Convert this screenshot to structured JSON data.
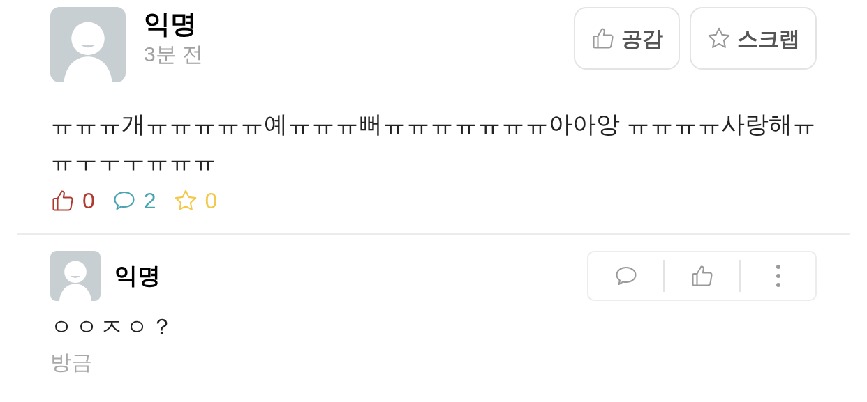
{
  "post": {
    "author": "익명",
    "time": "3분 전",
    "buttons": [
      {
        "kind": "like",
        "label": "공감"
      },
      {
        "kind": "scrap",
        "label": "스크랩"
      }
    ],
    "body": "ㅠㅠㅠ개ㅠㅠㅠㅠㅠ예ㅠㅠㅠ뻐ㅠㅠㅠㅠㅠㅠㅠ아아앙 ㅠㅠㅠㅠ사랑해ㅠㅠㅜㅜㅜㅠㅠㅠ",
    "stats": [
      {
        "kind": "like",
        "count": "0",
        "color": "#b03a2e"
      },
      {
        "kind": "comment",
        "count": "2",
        "color": "#4aa3b0"
      },
      {
        "kind": "scrap",
        "count": "0",
        "color": "#f2c94c"
      }
    ]
  },
  "comments": [
    {
      "author": "익명",
      "actions": [
        {
          "kind": "reply"
        },
        {
          "kind": "like"
        },
        {
          "kind": "more"
        }
      ],
      "text": "ㅇㅇㅈㅇ？",
      "time": "방금"
    }
  ]
}
